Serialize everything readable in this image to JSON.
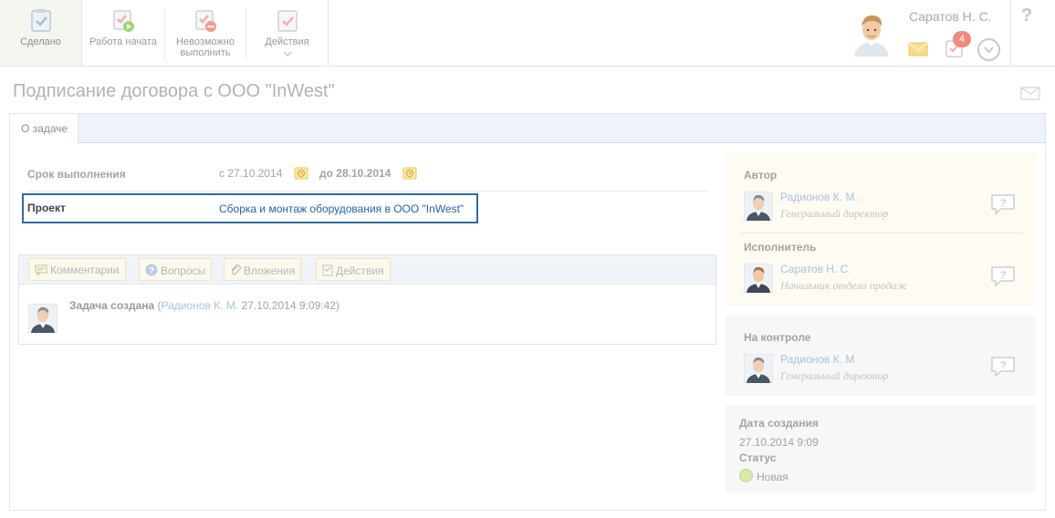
{
  "toolbar": {
    "done_label": "Сделано",
    "started_label": "Работа начата",
    "impossible_label": "Невозможно выполнить",
    "actions_label": "Действия"
  },
  "user": {
    "name": "Саратов Н. С.",
    "tasks_count": "4"
  },
  "help": {
    "label": "?"
  },
  "page": {
    "title": "Подписание договора с ООО \"InWest\""
  },
  "tabs": [
    {
      "label": "О задаче"
    }
  ],
  "details": {
    "deadline_label": "Срок выполнения",
    "deadline_from": "с 27.10.2014",
    "deadline_to": "до 28.10.2014",
    "project_label": "Проект",
    "project_value": "Сборка и монтаж оборудования в ООО \"InWest\""
  },
  "activity": {
    "tabs": [
      "Комментарии",
      "Вопросы",
      "Вложения",
      "Действия"
    ],
    "log": {
      "event": "Задача создана",
      "open_paren": " (",
      "author": "Радионов К. М.",
      "timestamp": " 27.10.2014 9:09:42)"
    }
  },
  "side": {
    "author_label": "Автор",
    "author_name": "Радионов К. М.",
    "author_position": "Генеральный директор",
    "executor_label": "Исполнитель",
    "executor_name": "Саратов Н. С.",
    "executor_position": "Начальник отдела продаж",
    "control_label": "На контроле",
    "control_name": "Радионов К. М.",
    "control_position": "Генеральный директор",
    "created_label": "Дата создания",
    "created_value": "27.10.2014 9:09",
    "status_label": "Статус",
    "status_value": "Новая"
  },
  "colors": {
    "link": "#2462a8",
    "project_border": "#2f6ba0",
    "badge": "#f08a7a"
  }
}
